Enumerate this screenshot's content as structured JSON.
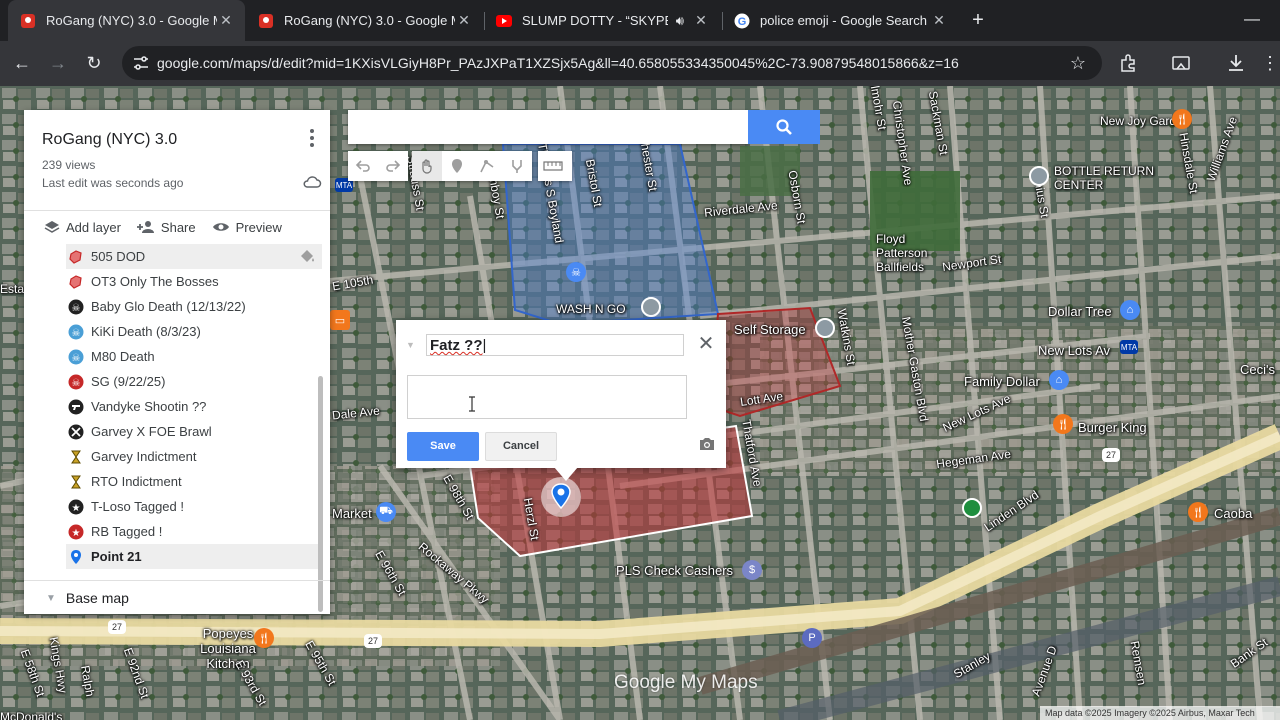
{
  "browser": {
    "tabs": [
      {
        "title": "RoGang (NYC) 3.0 - Google My",
        "icon": "google-maps-pin-icon",
        "active": true
      },
      {
        "title": "RoGang (NYC) 3.0 - Google My",
        "icon": "google-maps-pin-icon",
        "active": false
      },
      {
        "title": "SLUMP DOTTY - “SKYPE”(O",
        "icon": "youtube-icon",
        "active": false
      },
      {
        "title": "police emoji - Google Search",
        "icon": "google-g-icon",
        "active": false
      }
    ],
    "url": "google.com/maps/d/edit?mid=1KXisVLGiyH8Pr_PAzJXPaT1XZSjx5Ag&ll=40.658055334350045%2C-73.90879548015866&z=16"
  },
  "panel": {
    "title": "RoGang (NYC) 3.0",
    "views": "239 views",
    "last_edit": "Last edit was seconds ago",
    "actions": {
      "add_layer": "Add layer",
      "share": "Share",
      "preview": "Preview"
    },
    "items": [
      {
        "label": "505 DOD",
        "icon": "red-polygon-icon"
      },
      {
        "label": "OT3 Only The Bosses",
        "icon": "red-polygon-icon"
      },
      {
        "label": "Baby Glo Death (12/13/22)",
        "icon": "skull-icon"
      },
      {
        "label": "KiKi Death (8/3/23)",
        "icon": "skull-icon"
      },
      {
        "label": "M80 Death",
        "icon": "skull-icon"
      },
      {
        "label": "SG (9/22/25)",
        "icon": "skull-icon"
      },
      {
        "label": "Vandyke Shootin ??",
        "icon": "gun-icon"
      },
      {
        "label": "Garvey X FOE Brawl",
        "icon": "crossed-swords-icon"
      },
      {
        "label": "Garvey Indictment",
        "icon": "hourglass-icon"
      },
      {
        "label": "RTO Indictment",
        "icon": "hourglass-icon"
      },
      {
        "label": "T-Loso Tagged !",
        "icon": "star-badge-icon"
      },
      {
        "label": "RB Tagged !",
        "icon": "star-badge-icon"
      },
      {
        "label": "Point 21",
        "icon": "blue-pin-icon"
      }
    ],
    "base_map": "Base map"
  },
  "infowindow": {
    "name_value": "Fatz ??",
    "description_value": "",
    "save_label": "Save",
    "cancel_label": "Cancel"
  },
  "map_labels": {
    "streets": [
      "Riverdale Ave",
      "Newport St",
      "Lott Ave",
      "Hegeman Ave",
      "New Lots Ave",
      "Linden Blvd",
      "Rockaway Pkwy",
      "Sackman St",
      "Christopher Ave",
      "Thatford Ave",
      "Osborn St",
      "Watkins St",
      "Mother Gaston Blvd",
      "Junius St",
      "Hinsdale St",
      "Williams Ave",
      "Bristol St",
      "Chester St",
      "Amboy St",
      "Herzl St",
      "Thomas S Boyland",
      "Strauss St",
      "E 98th St",
      "E 96th St",
      "E 95th St",
      "E 93rd St",
      "E 92nd St",
      "E 58th St",
      "Kings Hwy",
      "Ralph",
      "Remsen",
      "Bank St",
      "Stanley",
      "Avenue D",
      "E 105th",
      "Dale Ave",
      "Hillmohr St",
      "Blvd"
    ],
    "places": [
      "New Joy Garden",
      "BOTTLE RETURN CENTER",
      "Floyd Patterson Ballfields",
      "Dollar Tree",
      "Self Storage",
      "New Lots Av",
      "Family Dollar",
      "Ceci's",
      "Burger King",
      "Caoba",
      "WASH N GO",
      "PLS Check Cashers",
      "Popeyes Louisiana Kitchen",
      "Market",
      "McDonald's",
      "Esta"
    ],
    "route_shields": [
      "27",
      "27",
      "27"
    ]
  },
  "map_logo": "Google My Maps",
  "attribution": "Map data ©2025 Imagery ©2025 Airbus, Maxar Tech",
  "colors": {
    "accent": "#4a8af4",
    "polygon_red": "#c2353a",
    "polygon_blue": "#4a7fd6"
  }
}
